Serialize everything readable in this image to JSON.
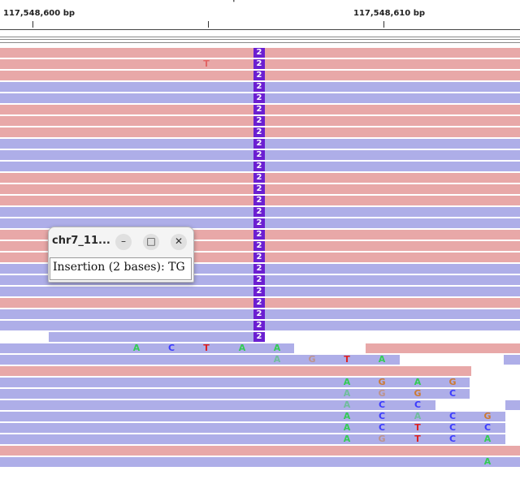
{
  "ruler": {
    "labels": [
      "117,548,600 bp",
      "117,548,610 bp"
    ],
    "top_fragment": "|"
  },
  "insertion": {
    "count_label": "2",
    "bases": "TG"
  },
  "popup": {
    "title": "chr7_11...",
    "text": "Insertion (2 bases): TG",
    "minimize_icon": "minimize-icon",
    "maximize_icon": "maximize-icon",
    "close_icon": "close-icon"
  },
  "colors": {
    "forward_read": "#e8a8a8",
    "reverse_read": "#aeaee8",
    "insertion": "#6b1fd1",
    "base_A": "#33cc55",
    "base_C": "#3b3bff",
    "base_G": "#cc7a33",
    "base_T": "#dd2222"
  },
  "reads": [
    {
      "strand": "fwd",
      "bases": [],
      "insertion": true
    },
    {
      "strand": "fwd",
      "bases": [
        {
          "b": "T",
          "faint": true
        }
      ],
      "insertion": true
    },
    {
      "strand": "fwd",
      "bases": [],
      "insertion": true
    },
    {
      "strand": "rev",
      "bases": [],
      "insertion": true
    },
    {
      "strand": "rev",
      "bases": [],
      "insertion": true
    },
    {
      "strand": "fwd",
      "bases": [],
      "insertion": true
    },
    {
      "strand": "fwd",
      "bases": [],
      "insertion": true
    },
    {
      "strand": "fwd",
      "bases": [],
      "insertion": true
    },
    {
      "strand": "rev",
      "bases": [],
      "insertion": true
    },
    {
      "strand": "rev",
      "bases": [],
      "insertion": true
    },
    {
      "strand": "rev",
      "bases": [],
      "insertion": true
    },
    {
      "strand": "fwd",
      "bases": [],
      "insertion": true
    },
    {
      "strand": "fwd",
      "bases": [],
      "insertion": true
    },
    {
      "strand": "fwd",
      "bases": [],
      "insertion": true
    },
    {
      "strand": "rev",
      "bases": [],
      "insertion": true
    },
    {
      "strand": "rev",
      "bases": [],
      "insertion": true
    },
    {
      "strand": "fwd",
      "bases": [],
      "insertion": true
    },
    {
      "strand": "fwd",
      "bases": [],
      "insertion": true
    },
    {
      "strand": "fwd",
      "bases": [],
      "insertion": true
    },
    {
      "strand": "rev",
      "bases": [],
      "insertion": true
    },
    {
      "strand": "rev",
      "bases": [],
      "insertion": true
    },
    {
      "strand": "rev",
      "bases": [],
      "insertion": true
    },
    {
      "strand": "fwd",
      "bases": [],
      "insertion": true
    },
    {
      "strand": "rev",
      "bases": [],
      "insertion": true
    },
    {
      "strand": "rev",
      "bases": [],
      "insertion": true
    },
    {
      "strand": "rev",
      "bases": [],
      "insertion": true
    },
    {
      "strand": "rev",
      "bases": [
        "A",
        "C",
        "T",
        "A",
        "A"
      ],
      "insertion": false
    },
    {
      "strand": "rev",
      "bases": [
        {
          "b": "A",
          "faint": true
        },
        {
          "b": "G",
          "faint": true
        },
        "T",
        "A"
      ],
      "insertion": false
    },
    {
      "strand": "fwd",
      "bases": [],
      "insertion": false
    },
    {
      "strand": "rev",
      "bases": [
        "A",
        "G",
        "A",
        "G"
      ],
      "insertion": false
    },
    {
      "strand": "rev",
      "bases": [
        {
          "b": "A",
          "faint": true
        },
        {
          "b": "G",
          "faint": true
        },
        "G",
        "C"
      ],
      "insertion": false
    },
    {
      "strand": "rev",
      "bases": [
        {
          "b": "A",
          "faint": true
        },
        "C",
        "C"
      ],
      "insertion": false
    },
    {
      "strand": "rev",
      "bases": [
        "A",
        "C",
        {
          "b": "A",
          "faint": true
        },
        "C",
        "G"
      ],
      "insertion": false
    },
    {
      "strand": "rev",
      "bases": [
        "A",
        "C",
        "T",
        "C",
        "C"
      ],
      "insertion": false
    },
    {
      "strand": "rev",
      "bases": [
        "A",
        {
          "b": "G",
          "faint": true
        },
        "T",
        "C",
        "A"
      ],
      "insertion": false
    },
    {
      "strand": "fwd",
      "bases": [],
      "insertion": false
    },
    {
      "strand": "rev",
      "bases": [
        "A"
      ],
      "insertion": false
    }
  ]
}
